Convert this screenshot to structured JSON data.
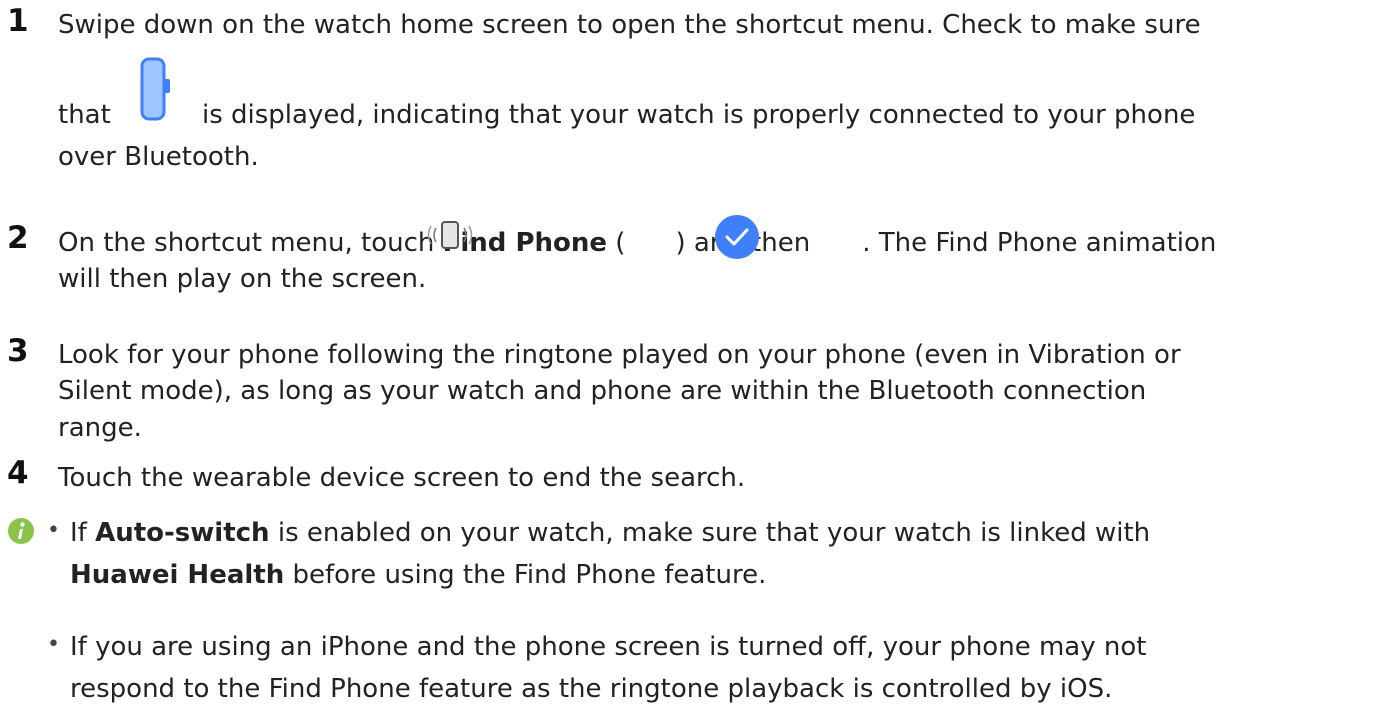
{
  "steps": [
    {
      "number": "1",
      "lines": [
        "Swipe down on the watch home screen to open the shortcut menu. Check to make sure",
        "that",
        "is displayed, indicating that your watch is properly connected to your phone",
        "over Bluetooth."
      ],
      "icon": "watch-connected-icon"
    },
    {
      "number": "2",
      "text_a": "On the shortcut menu, touch ",
      "bold_a": "Find Phone",
      "text_b": " (",
      "text_c": ") and then",
      "text_d": ". The Find Phone animation",
      "line2": "will then play on the screen.",
      "icons": [
        "find-phone-icon",
        "checkmark-confirm-icon"
      ]
    },
    {
      "number": "3",
      "lines": [
        "Look for your phone following the ringtone played on your phone (even in Vibration or",
        "Silent mode), as long as your watch and phone are within the Bluetooth connection",
        "range."
      ]
    },
    {
      "number": "4",
      "lines": [
        "Touch the wearable device screen to end the search."
      ]
    }
  ],
  "notes": {
    "icon": "info-icon",
    "items": [
      {
        "a": "If ",
        "bold_a": "Auto-switch",
        "b": " is enabled on your watch, make sure that your watch is linked with",
        "bold_b": "Huawei Health",
        "c": " before using the Find Phone feature."
      },
      {
        "line1": "If you are using an iPhone and the phone screen is turned off, your phone may not",
        "line2": "respond to the Find Phone feature as the ringtone playback is controlled by iOS."
      }
    ]
  },
  "colors": {
    "accent_blue": "#3f7ff7",
    "watch_icon_blue": "#9fc4ff",
    "info_icon": "#8bc34a"
  }
}
